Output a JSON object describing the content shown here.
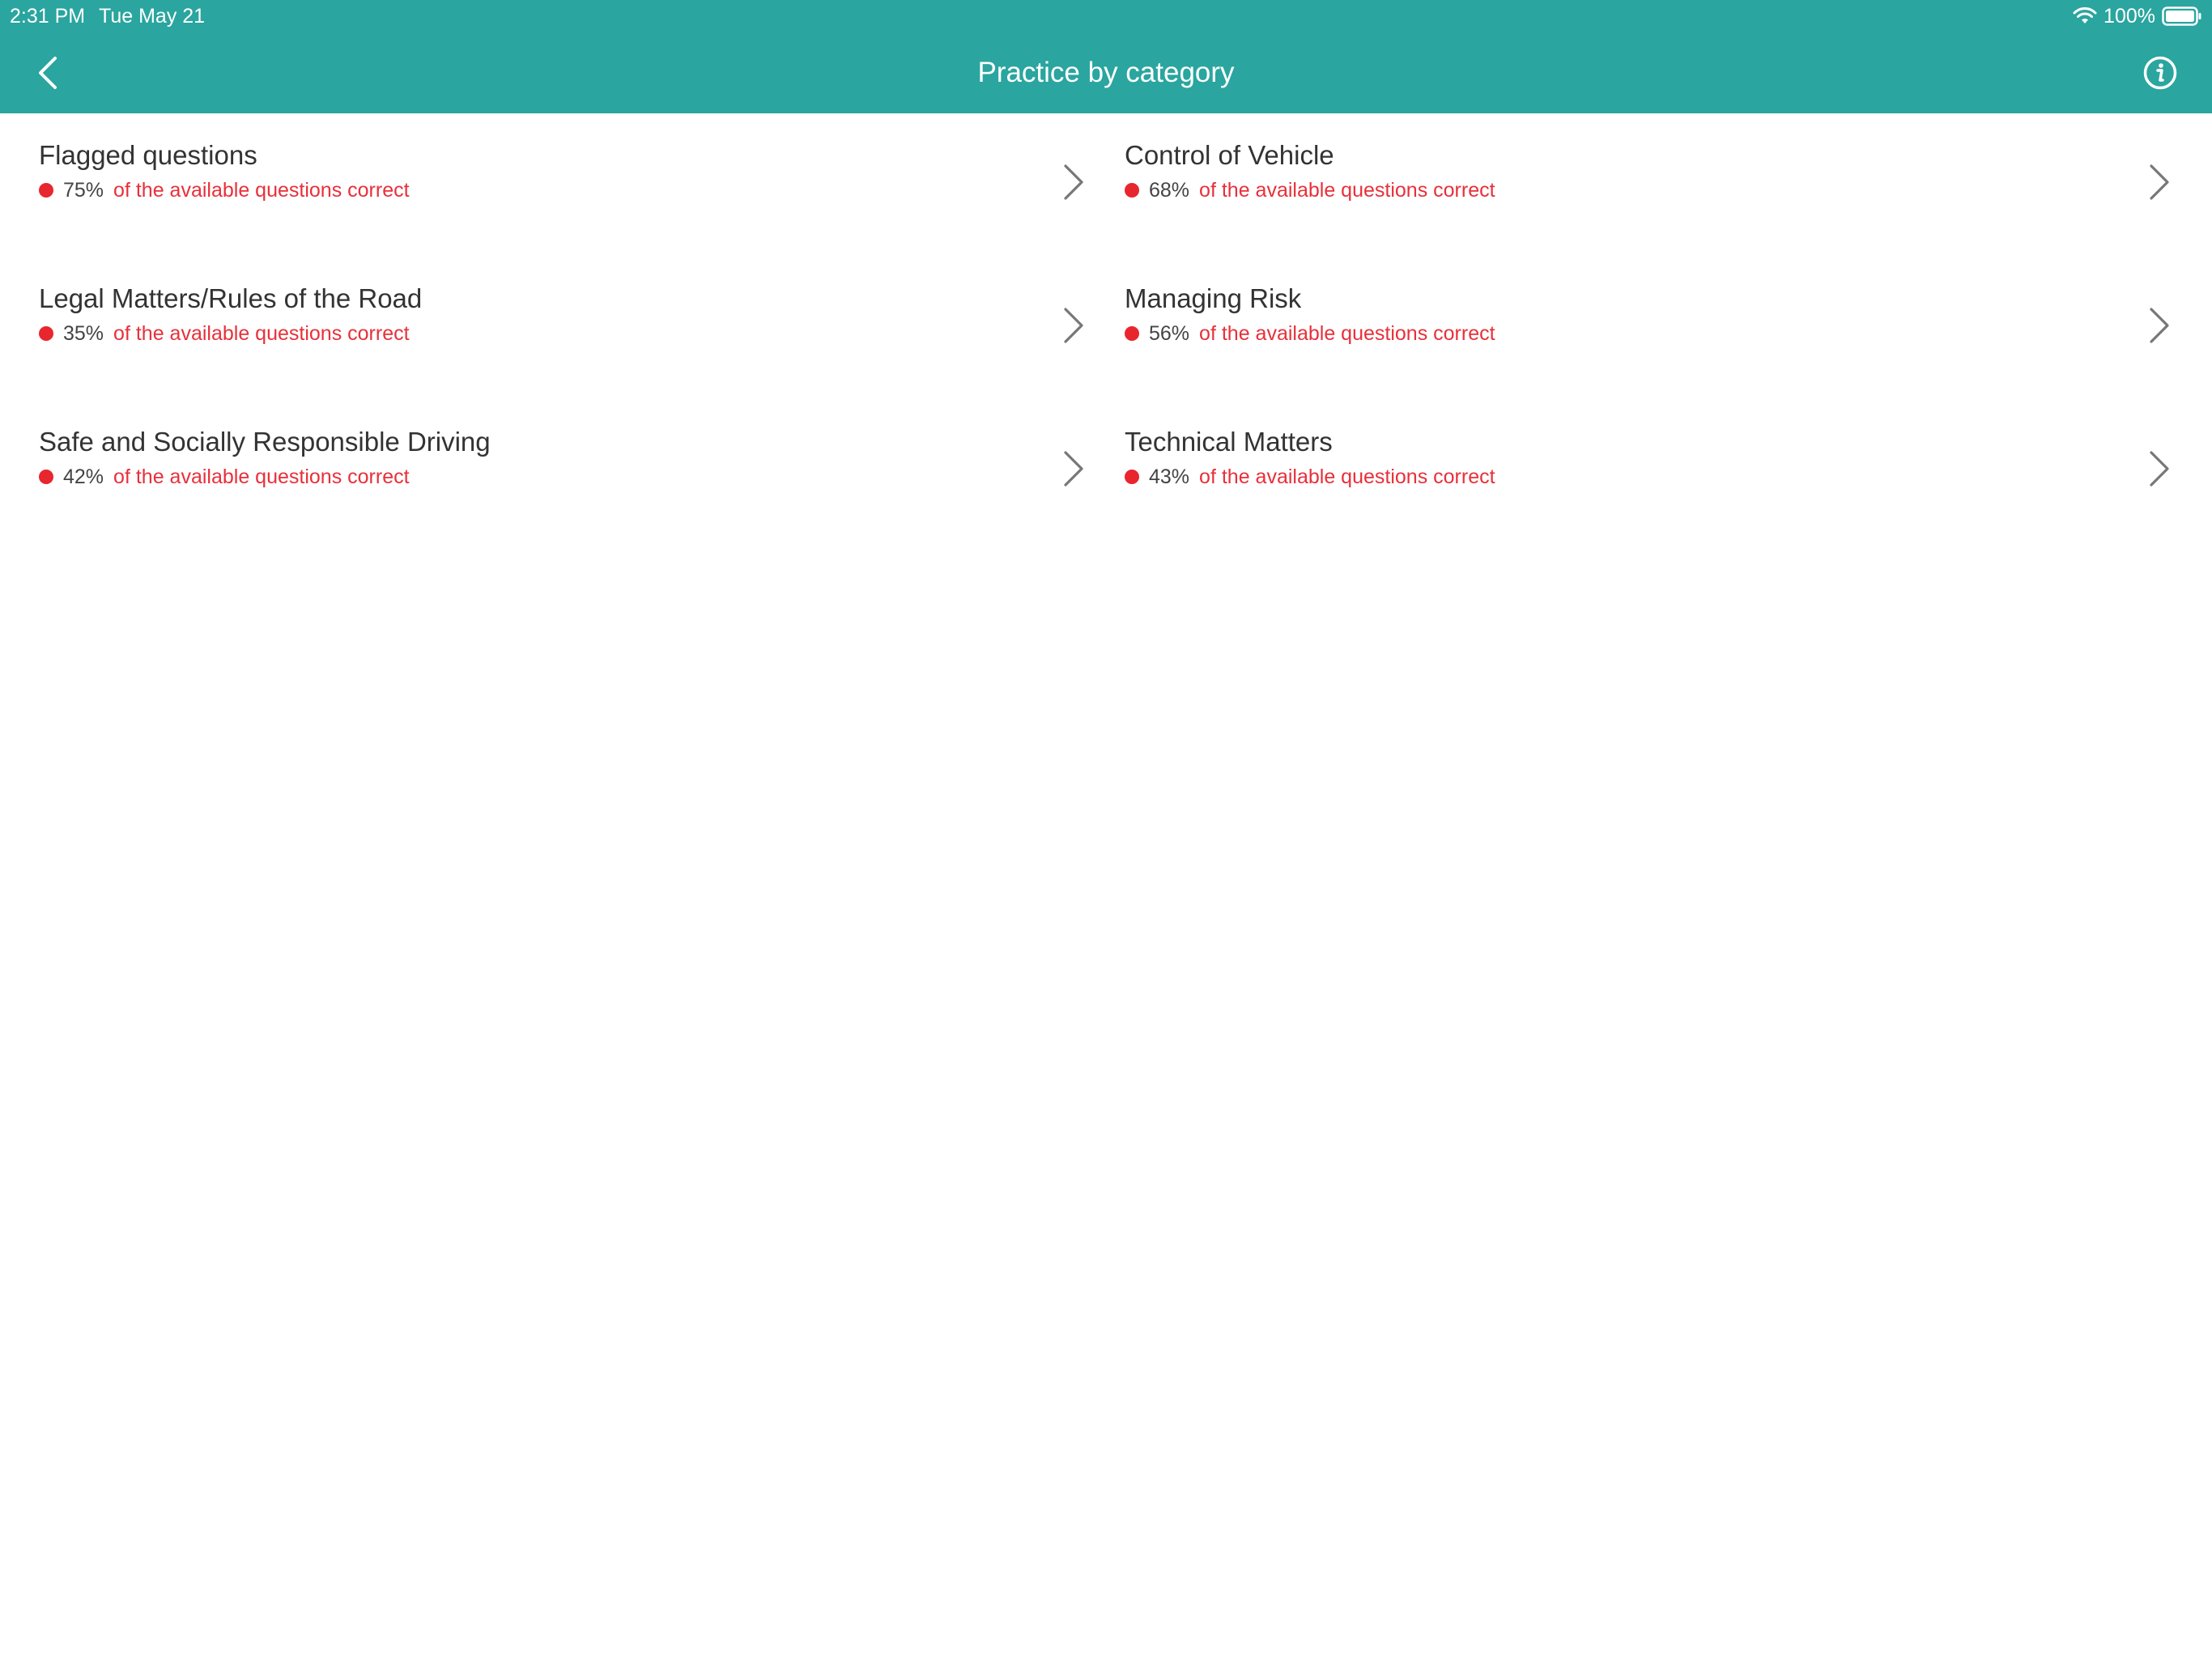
{
  "status_bar": {
    "time": "2:31 PM",
    "date": "Tue May 21",
    "battery": "100%"
  },
  "nav": {
    "title": "Practice by category"
  },
  "colors": {
    "header_bg": "#2aa59f",
    "status_dot": "#e8262e",
    "sub_text": "#e8303a"
  },
  "categories": [
    {
      "title": "Flagged questions",
      "percent": "75%",
      "subtitle": "of the available questions correct"
    },
    {
      "title": "Control of Vehicle",
      "percent": "68%",
      "subtitle": "of the available questions correct"
    },
    {
      "title": "Legal Matters/Rules of the Road",
      "percent": "35%",
      "subtitle": "of the available questions correct"
    },
    {
      "title": "Managing Risk",
      "percent": "56%",
      "subtitle": "of the available questions correct"
    },
    {
      "title": "Safe and Socially Responsible Driving",
      "percent": "42%",
      "subtitle": "of the available questions correct"
    },
    {
      "title": "Technical Matters",
      "percent": "43%",
      "subtitle": "of the available questions correct"
    }
  ]
}
